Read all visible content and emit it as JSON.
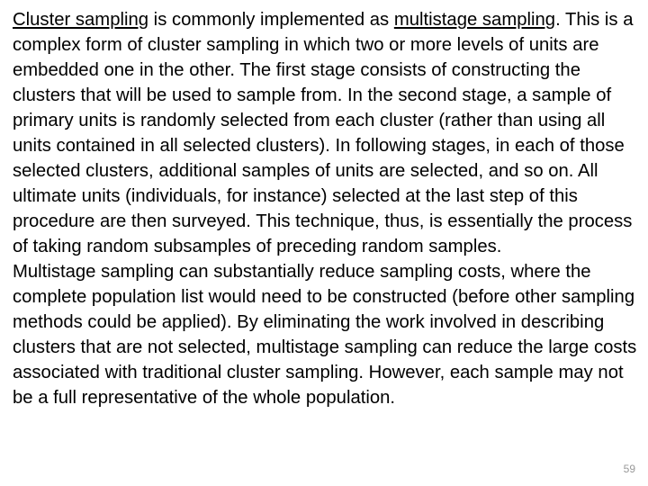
{
  "para1": {
    "link1": "Cluster sampling",
    "seg1": " is commonly implemented as ",
    "link2": "multistage sampling",
    "seg2": ".  This is a complex form of cluster sampling in which two or more levels of units are embedded one in the other. The first stage consists of constructing the clusters that will be used to sample from. In the second stage, a sample of primary units is randomly selected from each cluster (rather than using all units contained in all selected clusters). In following stages, in each of those selected clusters, additional samples of units are selected, and so on. All ultimate units (individuals, for instance) selected at the last step of this procedure are then surveyed. This technique, thus, is essentially the process of taking random subsamples of preceding random samples."
  },
  "para2": "Multistage sampling can substantially reduce sampling costs, where the complete population list would need to be constructed (before other sampling methods could be applied). By eliminating the work involved in describing clusters that are not selected, multistage sampling can reduce the large costs associated with traditional cluster sampling. However, each sample may not be a full representative of the whole population.",
  "page_number": "59"
}
